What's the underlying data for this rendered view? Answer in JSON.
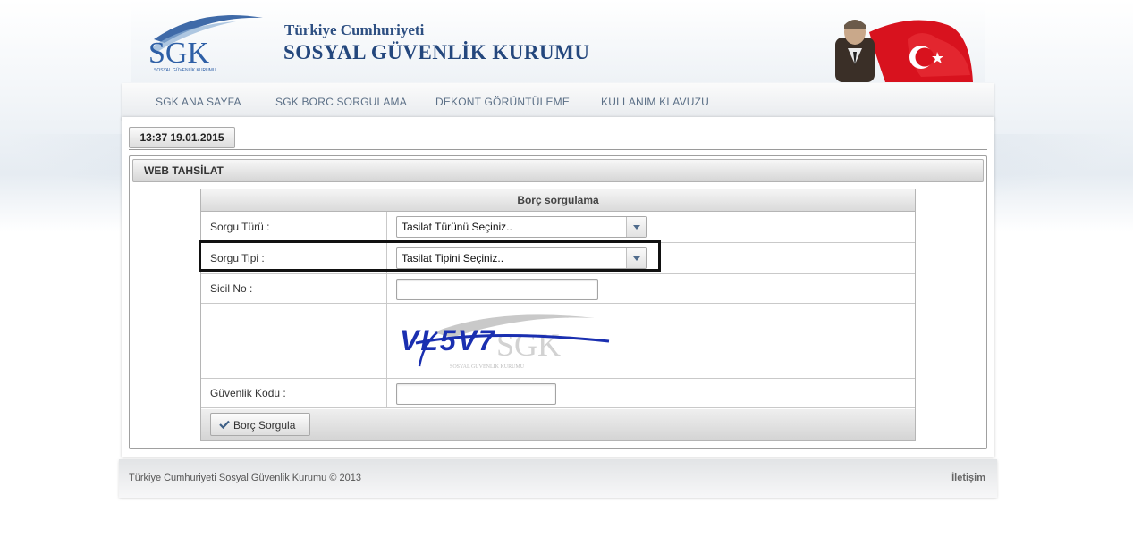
{
  "header": {
    "logo_text": "SGK",
    "logo_subtext": "SOSYAL GÜVENLİK KURUMU",
    "title_line1": "Türkiye Cumhuriyeti",
    "title_line2": "SOSYAL GÜVENLİK KURUMU"
  },
  "nav": {
    "items": [
      {
        "label": "SGK ANA SAYFA"
      },
      {
        "label": "SGK BORC SORGULAMA"
      },
      {
        "label": "DEKONT GÖRÜNTÜLEME"
      },
      {
        "label": "KULLANIM KLAVUZU"
      }
    ]
  },
  "clock": {
    "label": "13:37 19.01.2015"
  },
  "panel": {
    "title": "WEB TAHSİLAT"
  },
  "form": {
    "title": "Borç sorgulama",
    "sorgu_turu": {
      "label": "Sorgu Türü :",
      "selected": "Tasilat Türünü Seçiniz.."
    },
    "sorgu_tipi": {
      "label": "Sorgu Tipi :",
      "selected": "Tasilat Tipini Seçiniz.."
    },
    "sicil_no": {
      "label": "Sicil No :",
      "value": ""
    },
    "captcha": {
      "text": "VL5V7",
      "watermark": "SGK",
      "watermark_sub": "SOSYAL GÜVENLİK KURUMU"
    },
    "guvenlik_kodu": {
      "label": "Güvenlik Kodu :",
      "value": ""
    },
    "submit_label": "Borç Sorgula"
  },
  "footer": {
    "copyright": "Türkiye Cumhuriyeti Sosyal Güvenlik Kurumu © 2013",
    "contact": "İletişim"
  },
  "colors": {
    "brand_blue": "#24477d",
    "nav_text": "#5b6f86",
    "nav_border": "#9bb0c4",
    "captcha_blue": "#1a2fb0",
    "flag_red": "#d8121e"
  }
}
